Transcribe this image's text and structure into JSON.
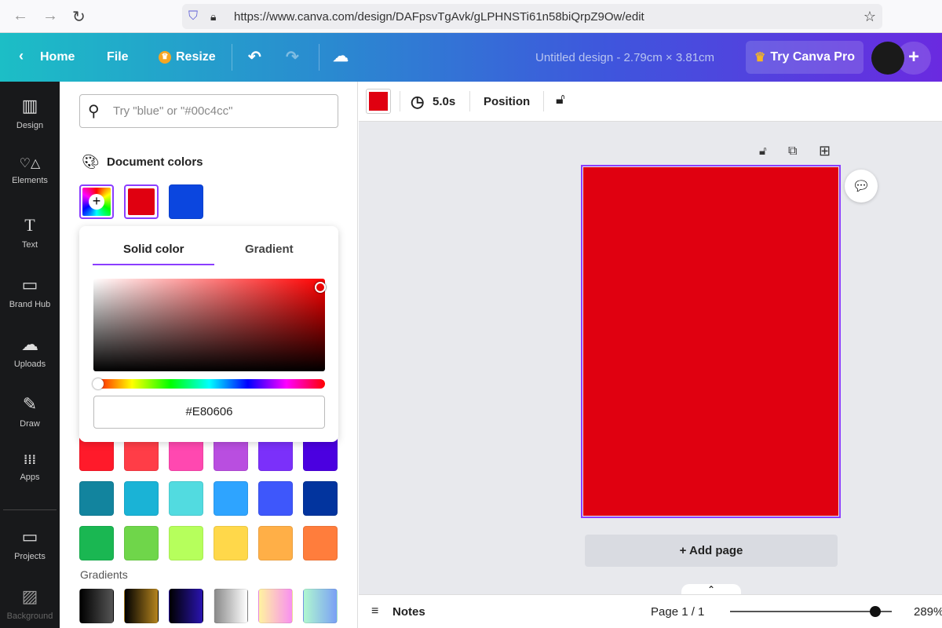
{
  "browser": {
    "url": "https://www.canva.com/design/DAFpsvTgAvk/gLPHNSTi61n58biQrpZ9Ow/edit"
  },
  "topbar": {
    "home": "Home",
    "file": "File",
    "resize": "Resize",
    "title": "Untitled design - 2.79cm × 3.81cm",
    "pro": "Try Canva Pro",
    "plus": "+"
  },
  "sidebar": {
    "items": [
      {
        "label": "Design",
        "icon": "▥"
      },
      {
        "label": "Elements",
        "icon": "♡△"
      },
      {
        "label": "Text",
        "icon": "T"
      },
      {
        "label": "Brand Hub",
        "icon": "▭"
      },
      {
        "label": "Uploads",
        "icon": "☁"
      },
      {
        "label": "Draw",
        "icon": "✎"
      },
      {
        "label": "Apps",
        "icon": "⁞⁞⁞"
      },
      {
        "label": "Projects",
        "icon": "▭"
      },
      {
        "label": "Background",
        "icon": "▨"
      }
    ]
  },
  "panel": {
    "search_placeholder": "Try \"blue\" or \"#00c4cc\"",
    "doc_colors_title": "Document colors",
    "doc_colors": [
      "#e00010",
      "#0b46df"
    ],
    "gradients_title": "Gradients",
    "default_colors": [
      [
        "#ff1a2a",
        "#ff3d47",
        "#ff48b0",
        "#b94ee0",
        "#7b30fa",
        "#4b00e0"
      ],
      [
        "#12849e",
        "#1ab3d6",
        "#52dbe0",
        "#2ea4ff",
        "#3e57fb",
        "#02349e"
      ],
      [
        "#1ab752",
        "#6fd64a",
        "#b6ff5c",
        "#ffd84a",
        "#ffaf47",
        "#ff7d3c"
      ]
    ],
    "gradients": [
      [
        "#000",
        "#555"
      ],
      [
        "#000",
        "#b5841e"
      ],
      [
        "#000",
        "#2a14b0"
      ],
      [
        "#888",
        "#fff"
      ],
      [
        "#fff3a0",
        "#f890f0"
      ],
      [
        "#b0f7d0",
        "#7aa0f5"
      ]
    ]
  },
  "picker": {
    "tab_solid": "Solid color",
    "tab_gradient": "Gradient",
    "hex": "#E80606",
    "hue": "#ff0000"
  },
  "context": {
    "color": "#e00010",
    "duration": "5.0s",
    "position": "Position"
  },
  "canvas": {
    "page_color": "#e00010",
    "add_page": "+ Add page"
  },
  "bottom": {
    "notes": "Notes",
    "page": "Page 1 / 1",
    "zoom": "289%",
    "zoom_level": 0.9
  }
}
